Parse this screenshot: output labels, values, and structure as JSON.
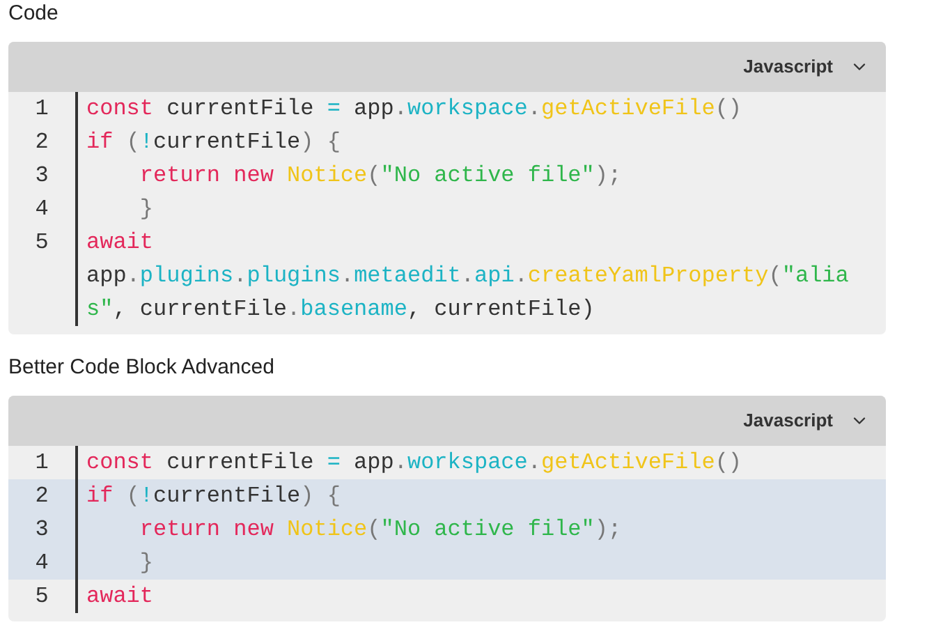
{
  "blocks": [
    {
      "label": "Code",
      "language": "Javascript",
      "lines": [
        {
          "number": "1",
          "highlighted": false,
          "tokens": [
            {
              "text": "const",
              "kind": "keyword"
            },
            {
              "text": " currentFile ",
              "kind": "plain"
            },
            {
              "text": "=",
              "kind": "operator"
            },
            {
              "text": " app",
              "kind": "plain"
            },
            {
              "text": ".",
              "kind": "punct"
            },
            {
              "text": "workspace",
              "kind": "property"
            },
            {
              "text": ".",
              "kind": "punct"
            },
            {
              "text": "getActiveFile",
              "kind": "function"
            },
            {
              "text": "()",
              "kind": "punct"
            }
          ]
        },
        {
          "number": "2",
          "highlighted": false,
          "tokens": [
            {
              "text": "if",
              "kind": "keyword"
            },
            {
              "text": " (",
              "kind": "punct"
            },
            {
              "text": "!",
              "kind": "operator"
            },
            {
              "text": "currentFile",
              "kind": "plain"
            },
            {
              "text": ") {",
              "kind": "punct"
            }
          ]
        },
        {
          "number": "3",
          "highlighted": false,
          "indented": true,
          "tokens": [
            {
              "text": "return new",
              "kind": "keyword"
            },
            {
              "text": " Notice",
              "kind": "function"
            },
            {
              "text": "(",
              "kind": "punct"
            },
            {
              "text": "\"No active file\"",
              "kind": "string"
            },
            {
              "text": ");",
              "kind": "punct"
            }
          ]
        },
        {
          "number": "4",
          "highlighted": false,
          "indented": true,
          "tokens": [
            {
              "text": "}",
              "kind": "punct"
            }
          ]
        },
        {
          "number": "5",
          "highlighted": false,
          "tokens": [
            {
              "text": "await",
              "kind": "keyword"
            },
            {
              "text": " app",
              "kind": "plain"
            },
            {
              "text": ".",
              "kind": "punct"
            },
            {
              "text": "plugins",
              "kind": "property"
            },
            {
              "text": ".",
              "kind": "punct"
            },
            {
              "text": "plugins",
              "kind": "property"
            },
            {
              "text": ".",
              "kind": "punct"
            },
            {
              "text": "metaedit",
              "kind": "property"
            },
            {
              "text": ".",
              "kind": "punct"
            },
            {
              "text": "api",
              "kind": "property"
            },
            {
              "text": ".",
              "kind": "punct"
            },
            {
              "text": "createYamlProperty",
              "kind": "function"
            },
            {
              "text": "(",
              "kind": "punct"
            },
            {
              "text": "\"alias\"",
              "kind": "string"
            },
            {
              "text": ", currentFile",
              "kind": "plain"
            },
            {
              "text": ".",
              "kind": "punct"
            },
            {
              "text": "basename",
              "kind": "property"
            },
            {
              "text": ", currentFile)",
              "kind": "plain"
            }
          ]
        }
      ]
    },
    {
      "label": "Better Code Block Advanced",
      "language": "Javascript",
      "lines": [
        {
          "number": "1",
          "highlighted": false,
          "tokens": [
            {
              "text": "const",
              "kind": "keyword"
            },
            {
              "text": " currentFile ",
              "kind": "plain"
            },
            {
              "text": "=",
              "kind": "operator"
            },
            {
              "text": " app",
              "kind": "plain"
            },
            {
              "text": ".",
              "kind": "punct"
            },
            {
              "text": "workspace",
              "kind": "property"
            },
            {
              "text": ".",
              "kind": "punct"
            },
            {
              "text": "getActiveFile",
              "kind": "function"
            },
            {
              "text": "()",
              "kind": "punct"
            }
          ]
        },
        {
          "number": "2",
          "highlighted": true,
          "tokens": [
            {
              "text": "if",
              "kind": "keyword"
            },
            {
              "text": " (",
              "kind": "punct"
            },
            {
              "text": "!",
              "kind": "operator"
            },
            {
              "text": "currentFile",
              "kind": "plain"
            },
            {
              "text": ") {",
              "kind": "punct"
            }
          ]
        },
        {
          "number": "3",
          "highlighted": true,
          "indented": true,
          "tokens": [
            {
              "text": "return new",
              "kind": "keyword"
            },
            {
              "text": " Notice",
              "kind": "function"
            },
            {
              "text": "(",
              "kind": "punct"
            },
            {
              "text": "\"No active file\"",
              "kind": "string"
            },
            {
              "text": ");",
              "kind": "punct"
            }
          ]
        },
        {
          "number": "4",
          "highlighted": true,
          "indented": true,
          "tokens": [
            {
              "text": "}",
              "kind": "punct"
            }
          ]
        },
        {
          "number": "5",
          "highlighted": false,
          "tokens": [
            {
              "text": "await",
              "kind": "keyword"
            }
          ]
        }
      ]
    }
  ]
}
